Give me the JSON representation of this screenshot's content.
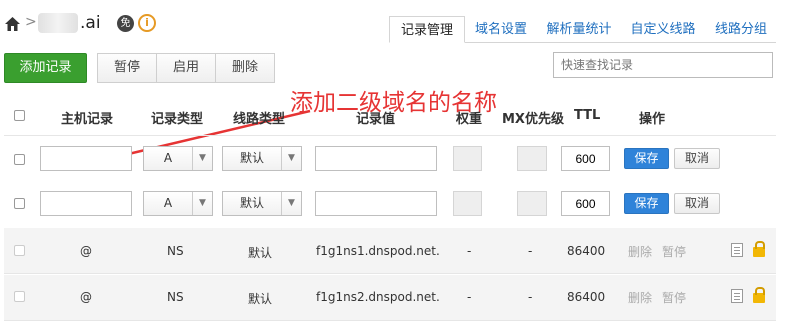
{
  "header": {
    "domain": ".ai",
    "free_badge": "免",
    "info_icon": "i"
  },
  "tabs": [
    {
      "label": "记录管理",
      "active": true
    },
    {
      "label": "域名设置",
      "active": false
    },
    {
      "label": "解析量统计",
      "active": false
    },
    {
      "label": "自定义线路",
      "active": false
    },
    {
      "label": "线路分组",
      "active": false
    }
  ],
  "toolbar": {
    "add_label": "添加记录",
    "pause_label": "暂停",
    "enable_label": "启用",
    "delete_label": "删除",
    "search_placeholder": "快速查找记录"
  },
  "annotation": "添加二级域名的名称",
  "columns": [
    "主机记录",
    "记录类型",
    "线路类型",
    "记录值",
    "权重",
    "MX优先级",
    "TTL",
    "操作"
  ],
  "edit_rows": [
    {
      "host": "",
      "type": "A",
      "line": "默认",
      "value": "",
      "ttl": "600",
      "save": "保存",
      "cancel": "取消"
    },
    {
      "host": "",
      "type": "A",
      "line": "默认",
      "value": "",
      "ttl": "600",
      "save": "保存",
      "cancel": "取消"
    }
  ],
  "records": [
    {
      "host": "@",
      "type": "NS",
      "line": "默认",
      "value": "f1g1ns1.dnspod.net.",
      "weight": "-",
      "mx": "-",
      "ttl": "86400",
      "delete": "删除",
      "pause": "暂停"
    },
    {
      "host": "@",
      "type": "NS",
      "line": "默认",
      "value": "f1g1ns2.dnspod.net.",
      "weight": "-",
      "mx": "-",
      "ttl": "86400",
      "delete": "删除",
      "pause": "暂停"
    }
  ],
  "colors": {
    "accent_green": "#3a9f2f",
    "save_blue": "#2f83d9",
    "annotation_red": "#e63434",
    "link_blue": "#1f6fbf"
  }
}
